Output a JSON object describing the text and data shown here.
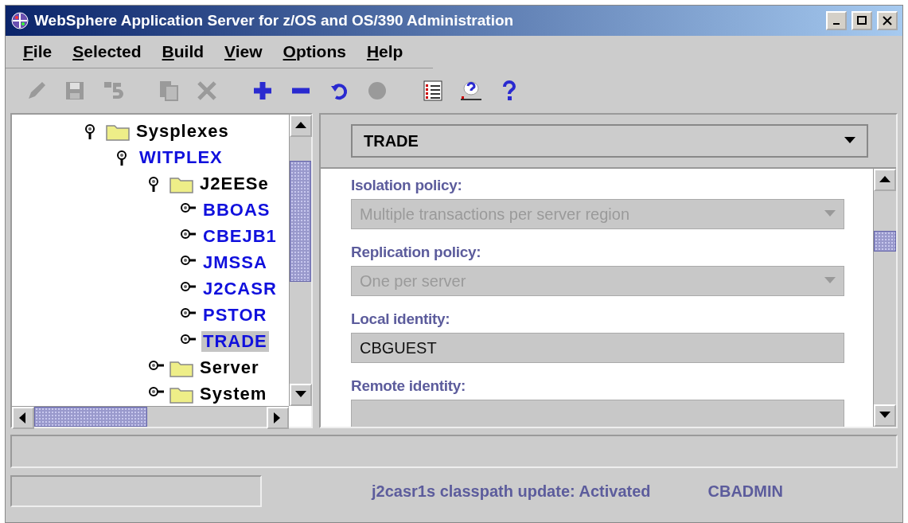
{
  "window": {
    "title": "WebSphere Application Server for z/OS and OS/390 Administration"
  },
  "menu": [
    "File",
    "Selected",
    "Build",
    "View",
    "Options",
    "Help"
  ],
  "toolbar": [
    {
      "kind": "pencil",
      "disabled": true
    },
    {
      "kind": "save",
      "disabled": true
    },
    {
      "kind": "undo",
      "disabled": true
    },
    {
      "kind": "gap"
    },
    {
      "kind": "paste",
      "disabled": true
    },
    {
      "kind": "delete",
      "disabled": true
    },
    {
      "kind": "gap"
    },
    {
      "kind": "add",
      "disabled": false
    },
    {
      "kind": "remove",
      "disabled": false
    },
    {
      "kind": "refresh",
      "disabled": false
    },
    {
      "kind": "stop",
      "disabled": true
    },
    {
      "kind": "gap"
    },
    {
      "kind": "list",
      "disabled": false
    },
    {
      "kind": "wizard",
      "disabled": false
    },
    {
      "kind": "help",
      "disabled": false
    }
  ],
  "tree": [
    {
      "label": "Sysplexes",
      "kind": "folder",
      "expanded": true,
      "selected": false,
      "children": [
        {
          "label": "WITPLEX",
          "kind": "item",
          "expanded": true,
          "selected": false,
          "children": [
            {
              "label": "J2EESe",
              "kind": "folder",
              "expanded": true,
              "selected": false,
              "children": [
                {
                  "label": "BBOAS",
                  "kind": "item",
                  "expanded": false,
                  "selected": false
                },
                {
                  "label": "CBEJB1",
                  "kind": "item",
                  "expanded": false,
                  "selected": false
                },
                {
                  "label": "JMSSA",
                  "kind": "item",
                  "expanded": false,
                  "selected": false
                },
                {
                  "label": "J2CASR",
                  "kind": "item",
                  "expanded": false,
                  "selected": false
                },
                {
                  "label": "PSTOR",
                  "kind": "item",
                  "expanded": false,
                  "selected": false
                },
                {
                  "label": "TRADE",
                  "kind": "item",
                  "expanded": false,
                  "selected": true
                }
              ]
            },
            {
              "label": "Server",
              "kind": "folder",
              "expanded": false,
              "selected": false
            },
            {
              "label": "System",
              "kind": "folder",
              "expanded": false,
              "selected": false
            }
          ]
        }
      ]
    }
  ],
  "selector": {
    "value": "TRADE"
  },
  "fields": [
    {
      "label": "Isolation policy:",
      "kind": "dropdown",
      "value": "Multiple transactions per server region",
      "disabled": true
    },
    {
      "label": "Replication policy:",
      "kind": "dropdown",
      "value": "One per server",
      "disabled": true
    },
    {
      "label": "Local identity:",
      "kind": "text",
      "value": "CBGUEST"
    },
    {
      "label": "Remote identity:",
      "kind": "text"
    }
  ],
  "status_bar": {
    "message": "j2casr1s classpath update: Activated",
    "user": "CBADMIN"
  }
}
